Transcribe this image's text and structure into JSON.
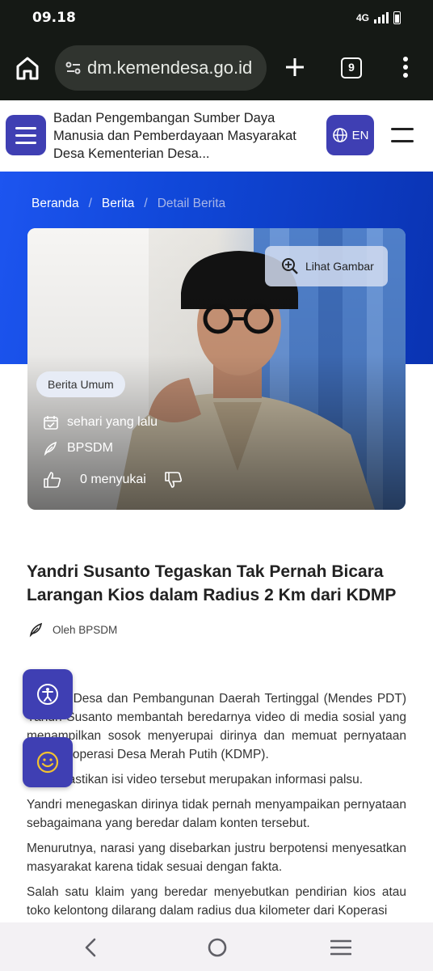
{
  "status_bar": {
    "time": "09.18",
    "network": "4G"
  },
  "browser": {
    "url": "dm.kemendesa.go.id",
    "tab_count": "9"
  },
  "header": {
    "site_title": "Badan Pengembangan Sumber Daya Manusia dan Pemberdayaan Masyarakat Desa Kementerian Desa...",
    "lang_label": "EN"
  },
  "breadcrumb": {
    "home": "Beranda",
    "news": "Berita",
    "current": "Detail Berita"
  },
  "feature": {
    "view_image_label": "Lihat Gambar",
    "category": "Berita Umum",
    "time_ago": "sehari yang lalu",
    "author": "BPSDM",
    "likes": "0 menyukai"
  },
  "article": {
    "title": "Yandri Susanto Tegaskan Tak Pernah Bicara Larangan Kios dalam Radius 2 Km dari KDMP",
    "byline": "Oleh BPSDM",
    "paragraphs": [
      "Menteri Desa dan Pembangunan Daerah Tertinggal (Mendes PDT) Yandri Susanto membantah beredarnya video di media sosial yang menampilkan sosok menyerupai dirinya dan memuat pernyataan terkait Koperasi Desa Merah Putih (KDMP).",
      "Ia memastikan isi video tersebut merupakan informasi palsu.",
      "Yandri menegaskan dirinya tidak pernah menyampaikan pernyataan sebagaimana yang beredar dalam konten tersebut.",
      "Menurutnya, narasi yang disebarkan justru berpotensi menyesatkan masyarakat karena tidak sesuai dengan fakta.",
      "Salah satu klaim yang beredar menyebutkan pendirian kios atau toko kelontong dilarang dalam radius dua kilometer dari Koperasi"
    ]
  },
  "colors": {
    "primary": "#3f3fb3",
    "hero_blue": "#1047d8",
    "browser_dark": "#151915"
  }
}
